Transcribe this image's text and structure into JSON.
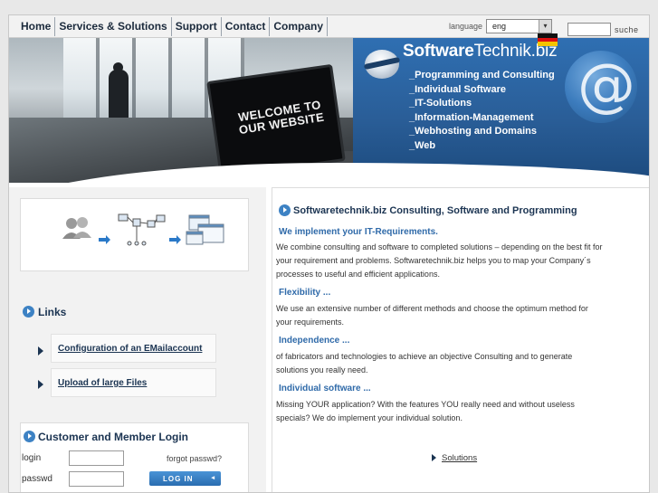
{
  "nav": {
    "items": [
      "Home",
      "Services & Solutions",
      "Support",
      "Contact",
      "Company"
    ]
  },
  "language": {
    "label": "language",
    "selected": "eng"
  },
  "search": {
    "label": "suche"
  },
  "banner": {
    "laptop_text_line1": "WELCOME TO",
    "laptop_text_line2": "OUR WEBSITE",
    "brand_bold": "Software",
    "brand_rest": "Technik.biz",
    "items": [
      "_Programming and Consulting",
      "_Individual Software",
      "_IT-Solutions",
      "_Information-Management",
      "_Webhosting and Domains",
      "_Web"
    ]
  },
  "links": {
    "title": "Links",
    "items": [
      "Configuration of an EMailaccount",
      "Upload of large Files"
    ]
  },
  "login": {
    "title": "Customer and Member Login",
    "login_label": "login",
    "passwd_label": "passwd",
    "forgot": "forgot passwd?",
    "button": "LOG IN"
  },
  "main": {
    "title": "Softwaretechnik.biz Consulting, Software and Programming",
    "sections": [
      {
        "heading": "We implement your IT-Requirements.",
        "text_lines": [
          "We combine consulting and software to completed solutions – depending on the best fit for",
          "your requirement and problems. Softwaretechnik.biz helps you to map your Company´s",
          "processes to useful and efficient applications."
        ]
      },
      {
        "heading": "Flexibility ...",
        "text_lines": [
          "We use an extensive number of different methods and choose the optimum method for",
          "your requirements."
        ]
      },
      {
        "heading": "Independence ...",
        "text_lines": [
          "of fabricators and technologies to achieve an objective Consulting and to generate",
          "solutions you really need."
        ]
      },
      {
        "heading": "Individual software ...",
        "text_lines": [
          "Missing YOUR application? With the features YOU really need and without useless",
          "specials? We do implement your individual solution."
        ]
      }
    ],
    "solutions_link": "Solutions"
  },
  "colors": {
    "accent_blue": "#2f6aa9",
    "dark_navy": "#1b3452",
    "banner_blue": "#2f6fb2"
  }
}
